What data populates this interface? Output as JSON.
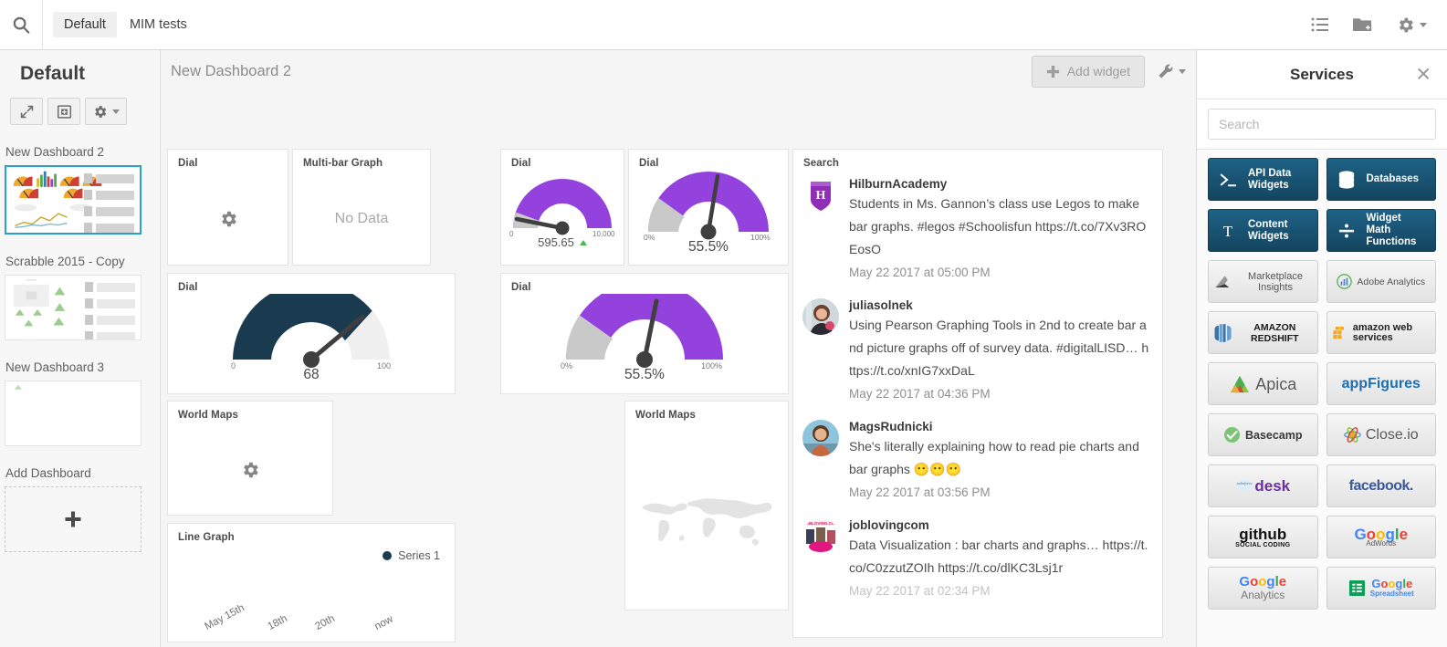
{
  "topbar": {
    "search_icon": "search-icon",
    "tabs": [
      {
        "label": "Default",
        "active": true
      },
      {
        "label": "MIM tests",
        "active": false
      }
    ],
    "icons": [
      "list-icon",
      "add-folder-icon",
      "gear-icon"
    ]
  },
  "sidebar": {
    "title": "Default",
    "buttons": [
      {
        "name": "expand-button",
        "icon": "expand-arrows-icon"
      },
      {
        "name": "import-button",
        "icon": "import-box-icon"
      },
      {
        "name": "settings-button",
        "icon": "gear-icon"
      }
    ],
    "dashboards": [
      {
        "label": "New Dashboard 2",
        "selected": true
      },
      {
        "label": "Scrabble 2015 - Copy",
        "selected": false
      },
      {
        "label": "New Dashboard 3",
        "selected": false
      }
    ],
    "add_dashboard_label": "Add Dashboard",
    "add_dashboard_glyph": "+"
  },
  "dashboard": {
    "title": "New Dashboard 2",
    "add_widget_label": "Add widget",
    "add_widget_glyph": "+",
    "tools_icon": "wrench-icon",
    "widgets": [
      {
        "title": "Dial",
        "state": "placeholder"
      },
      {
        "title": "Multi-bar Graph",
        "state": "no-data",
        "message": "No Data"
      },
      {
        "title": "Dial",
        "state": "gauge"
      },
      {
        "title": "Dial",
        "state": "gauge"
      },
      {
        "title": "Dial",
        "state": "gauge"
      },
      {
        "title": "Dial",
        "state": "gauge"
      },
      {
        "title": "World Maps",
        "state": "placeholder"
      },
      {
        "title": "World Maps",
        "state": "map"
      },
      {
        "title": "Line Graph",
        "state": "line"
      },
      {
        "title": "Search",
        "state": "tweets"
      }
    ],
    "dials": [
      {
        "id": "dial-595",
        "min_label": "0",
        "max_label": "10,000",
        "value_label": "595.65",
        "trend": "up",
        "fill_color": "#9442dd",
        "track_color": "#c9c9c9",
        "percent": 5.9
      },
      {
        "id": "dial-555-top",
        "min_label": "0%",
        "max_label": "100%",
        "value_label": "55.5%",
        "fill_color": "#9442dd",
        "track_color": "#c9c9c9",
        "percent": 55.5
      },
      {
        "id": "dial-68",
        "min_label": "0",
        "max_label": "100",
        "value_label": "68",
        "fill_color": "#1a3b4f",
        "track_color": "#f0f0f0",
        "percent": 68
      },
      {
        "id": "dial-555-bottom",
        "min_label": "0%",
        "max_label": "100%",
        "value_label": "55.5%",
        "fill_color": "#9442dd",
        "track_color": "#c9c9c9",
        "percent": 55.5
      }
    ],
    "line_graph": {
      "legend": "Series 1",
      "legend_color": "#1a3b4f",
      "x_ticks": [
        "May 15th",
        "18th",
        "20th",
        "now"
      ]
    },
    "search_widget": {
      "title": "Search",
      "tweets": [
        {
          "user": "HilburnAcademy",
          "text": "Students in Ms. Gannon’s class use Legos to make bar graphs. #legos #Schoolisfun https://t.co/7Xv3ROEosO",
          "time": "May 22 2017 at 05:00 PM",
          "avatar": "hilburn-academy-crest"
        },
        {
          "user": "juliasolnek",
          "text": "Using Pearson Graphing Tools in 2nd to create bar and picture graphs off of survey data. #digitalLISD… https://t.co/xnIG7xxDaL",
          "time": "May 22 2017 at 04:36 PM",
          "avatar": "julia-solnek-photo"
        },
        {
          "user": "MagsRudnicki",
          "text": "She's literally explaining how to read pie charts and bar graphs 😶😶😶",
          "time": "May 22 2017 at 03:56 PM",
          "avatar": "mags-rudnicki-photo"
        },
        {
          "user": "joblovingcom",
          "text": "Data Visualization : bar charts and graphs… https://t.co/C0zzutZOIh https://t.co/dlKC3Lsj1r",
          "time": "May 22 2017 at 02:34 PM",
          "avatar": "jobloving-logo"
        }
      ]
    }
  },
  "services": {
    "title": "Services",
    "close_icon": "close-icon",
    "search_placeholder": "Search",
    "search_value": "",
    "categories": [
      {
        "label": "API Data Widgets",
        "icon": "terminal-icon"
      },
      {
        "label": "Databases",
        "icon": "database-icon"
      },
      {
        "label": "Content Widgets",
        "icon": "text-t-icon"
      },
      {
        "label": "Widget Math Functions",
        "icon": "divide-icon"
      }
    ],
    "category_color": "#17506f",
    "tiles": [
      {
        "name": "marketplace-insights",
        "label": "Marketplace Insights"
      },
      {
        "name": "adobe-analytics",
        "label": "Adobe Analytics"
      },
      {
        "name": "amazon-redshift",
        "label": "AMAZON REDSHIFT"
      },
      {
        "name": "amazon-web-services",
        "label": "amazon web services"
      },
      {
        "name": "apica",
        "label": "Apica"
      },
      {
        "name": "appfigures",
        "label": "appFigures"
      },
      {
        "name": "basecamp",
        "label": "Basecamp"
      },
      {
        "name": "close-io",
        "label": "Close.io"
      },
      {
        "name": "salesforce-desk",
        "label": "desk"
      },
      {
        "name": "facebook",
        "label": "facebook."
      },
      {
        "name": "github",
        "label": "github SOCIAL CODING"
      },
      {
        "name": "google-adwords",
        "label": "Google AdWords"
      },
      {
        "name": "google-analytics",
        "label": "Google Analytics"
      },
      {
        "name": "google-spreadsheet",
        "label": "Google Spreadsheet"
      }
    ]
  }
}
